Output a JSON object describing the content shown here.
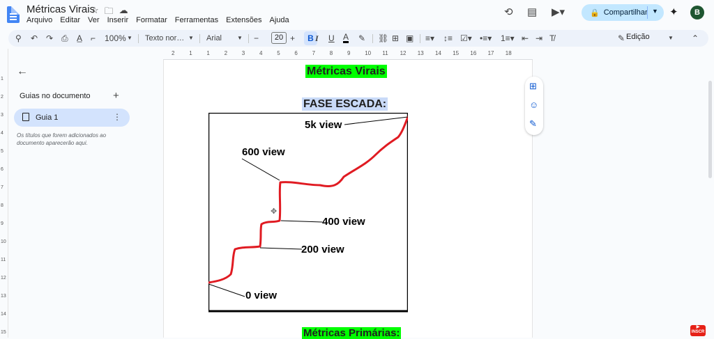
{
  "app": {
    "doc_title": "Métricas Virais",
    "menu": [
      "Arquivo",
      "Editar",
      "Ver",
      "Inserir",
      "Formatar",
      "Ferramentas",
      "Extensões",
      "Ajuda"
    ],
    "share_label": "Compartilhar",
    "avatar_initial": "B"
  },
  "toolbar": {
    "zoom": "100%",
    "style": "Texto nor…",
    "font": "Arial",
    "font_size": "20",
    "bold": "B",
    "italic": "I",
    "underline": "U",
    "text_color": "A",
    "mode": "Edição",
    "minus": "−",
    "plus": "+"
  },
  "ruler": {
    "h_numbers": [
      "2",
      "1",
      "1",
      "2",
      "3",
      "4",
      "5",
      "6",
      "7",
      "8",
      "9",
      "10",
      "11",
      "12",
      "13",
      "14",
      "15",
      "16",
      "17",
      "18"
    ],
    "v_numbers": [
      "1",
      "2",
      "3",
      "4",
      "5",
      "6",
      "7",
      "8",
      "9",
      "10",
      "11",
      "12",
      "13",
      "14",
      "15"
    ]
  },
  "sidebar": {
    "title": "Guias no documento",
    "tab_label": "Guia 1",
    "hint": "Os títulos que forem adicionados ao documento aparecerão aqui."
  },
  "document": {
    "heading1": "Métricas Virais",
    "heading2": "FASE ESCADA:",
    "heading3": "Métricas Primárias:"
  },
  "figure": {
    "labels": [
      "5k view",
      "600 view",
      "400 view",
      "200 view",
      "0 view"
    ]
  },
  "colors": {
    "accent": "#0b57d0",
    "share_bg": "#c2e7ff",
    "highlight_green": "#00ff00",
    "highlight_blue": "#c9daf8",
    "curve": "#e01b22"
  }
}
